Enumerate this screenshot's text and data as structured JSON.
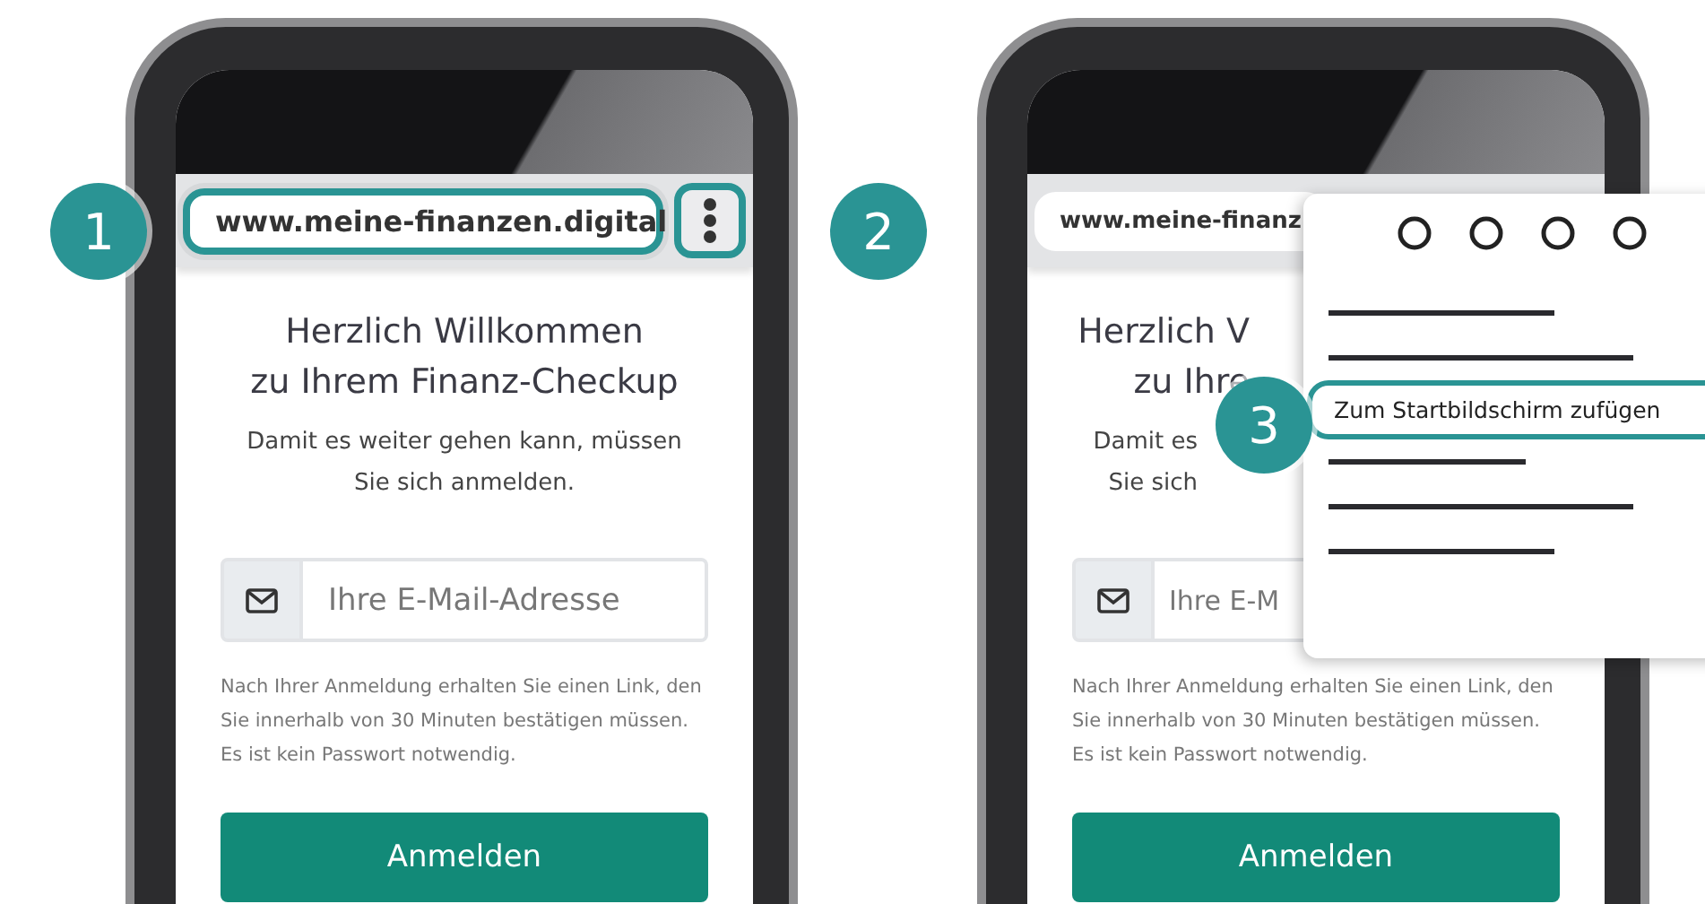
{
  "phones": [
    {
      "address": {
        "text": "www.meine-finanzen.digital",
        "highlighted": true,
        "callout": "1"
      },
      "menu_button": {
        "highlighted": true,
        "callout": "2"
      },
      "heading": [
        "Herzlich Willkommen",
        "zu Ihrem Finanz-Checkup"
      ],
      "intro": [
        "Damit es weiter gehen kann, müssen",
        "Sie sich anmelden."
      ],
      "email_placeholder": "Ihre E-Mail-Adresse",
      "note": "Nach Ihrer Anmeldung erhalten Sie einen Link, den Sie innerhalb von 30 Minuten bestätigen müssen. Es ist kein Passwort notwendig.",
      "button": "Anmelden"
    },
    {
      "address": {
        "text": "www.meine-finanz",
        "highlighted": false
      },
      "heading": [
        "Herzlich V",
        "zu Ihre"
      ],
      "intro": [
        "Damit es",
        "Sie sich"
      ],
      "email_placeholder": "Ihre E-M",
      "note": "Nach Ihrer Anmeldung erhalten Sie einen Link, den Sie innerhalb von 30 Minuten bestätigen müssen. Es ist kein Passwort notwendig.",
      "button": "Anmelden",
      "menu": {
        "items": [
          {
            "kind": "line"
          },
          {
            "kind": "line"
          },
          {
            "kind": "entry",
            "label": "Zum Startbildschirm zufügen",
            "selected": true,
            "callout": "3"
          },
          {
            "kind": "line"
          },
          {
            "kind": "line"
          },
          {
            "kind": "line"
          }
        ]
      }
    }
  ]
}
